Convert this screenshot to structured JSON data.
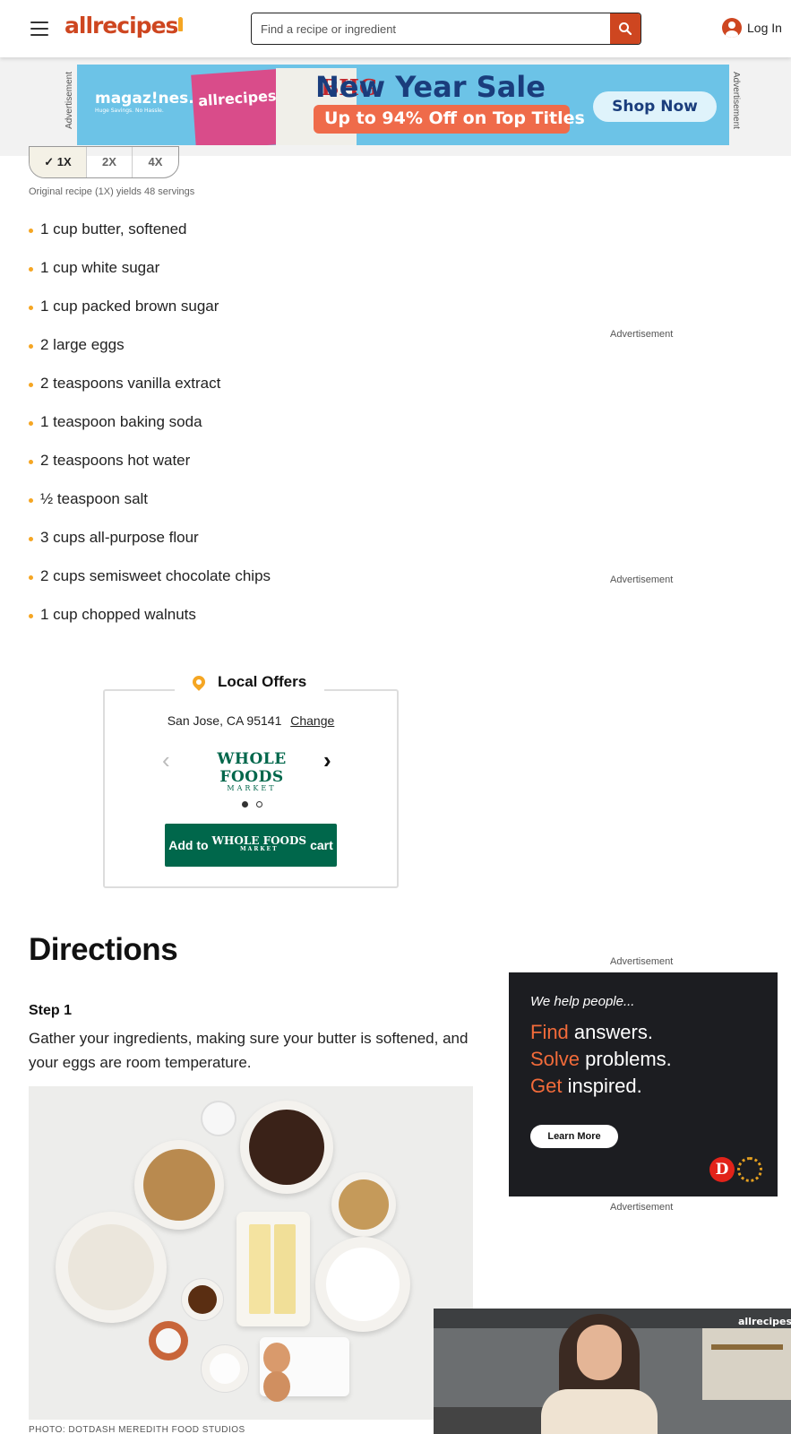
{
  "header": {
    "logo": "allrecipes",
    "search_placeholder": "Find a recipe or ingredient",
    "login_label": "Log In"
  },
  "top_ad": {
    "label": "Advertisement",
    "brand": "magaz!nes.com",
    "brand_tagline": "Huge Savings. No Hassle.",
    "cover_title": "allrecipes",
    "cover2_title": "BHG",
    "headline": "New Year Sale",
    "offer": "Up to 94% Off on Top Titles",
    "cta": "Shop Now"
  },
  "servings": {
    "options": [
      "1X",
      "2X",
      "4X"
    ],
    "selected": "1X",
    "yields_note": "Original recipe (1X) yields 48 servings"
  },
  "ingredients": [
    "1 cup butter, softened",
    "1 cup white sugar",
    "1 cup packed brown sugar",
    "2 large eggs",
    "2 teaspoons vanilla extract",
    "1 teaspoon baking soda",
    "2 teaspoons hot water",
    "½ teaspoon salt",
    "3 cups all-purpose flour",
    "2 cups semisweet chocolate chips",
    "1 cup chopped walnuts"
  ],
  "ad_labels": {
    "text": "Advertisement"
  },
  "local_offers": {
    "title": "Local Offers",
    "location": "San Jose, CA 95141",
    "change_label": "Change",
    "store_name": "WHOLE FOODS",
    "store_sub": "MARKET",
    "button_prefix": "Add to",
    "button_suffix": "cart",
    "carousel_index": 1,
    "carousel_total": 2
  },
  "directions": {
    "title": "Directions",
    "step_label": "Step 1",
    "step_text": "Gather your ingredients, making sure your butter is softened, and your eggs are room temperature.",
    "photo_credit": "PHOTO: DOTDASH MEREDITH FOOD STUDIOS"
  },
  "side_ad": {
    "intro": "We help people...",
    "lines": [
      {
        "accent": "Find",
        "rest": "answers."
      },
      {
        "accent": "Solve",
        "rest": "problems."
      },
      {
        "accent": "Get",
        "rest": "inspired."
      }
    ],
    "cta": "Learn More",
    "badge": "D"
  },
  "video": {
    "logo": "allrecipes"
  },
  "colors": {
    "brand": "#ce4620",
    "accent": "#f5a623",
    "wholefoods": "#00674b",
    "ad_orange": "#f26b3a"
  }
}
